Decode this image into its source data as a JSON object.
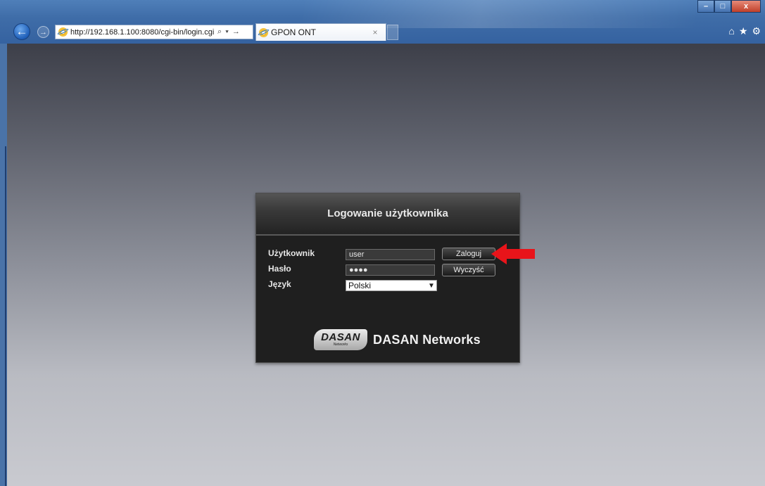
{
  "browser": {
    "url": "http://192.168.1.100:8080/cgi-bin/login.cgi",
    "address_tools": "⌕ ▾ →",
    "tab_title": "GPON ONT",
    "tab_close": "×",
    "back_glyph": "←",
    "forward_glyph": "→",
    "window_min": "–",
    "window_max": "□",
    "window_close": "x",
    "home_glyph": "⌂",
    "favorites_glyph": "★",
    "tools_glyph": "⚙"
  },
  "login": {
    "title": "Logowanie użytkownika",
    "user_label": "Użytkownik",
    "user_value": "user",
    "password_label": "Hasło",
    "password_value": "●●●●",
    "language_label": "Język",
    "language_value": "Polski",
    "login_button": "Zaloguj",
    "clear_button": "Wyczyść",
    "logo_mark": "DASAN",
    "logo_mark_sub": "Networks",
    "logo_text": "DASAN Networks"
  },
  "colors": {
    "annotation_arrow": "#e8141a",
    "panel_bg": "#1f1f1f"
  },
  "icons": [
    "back-icon",
    "forward-icon",
    "ie-icon",
    "search-icon",
    "home-icon",
    "star-icon",
    "gear-icon"
  ]
}
